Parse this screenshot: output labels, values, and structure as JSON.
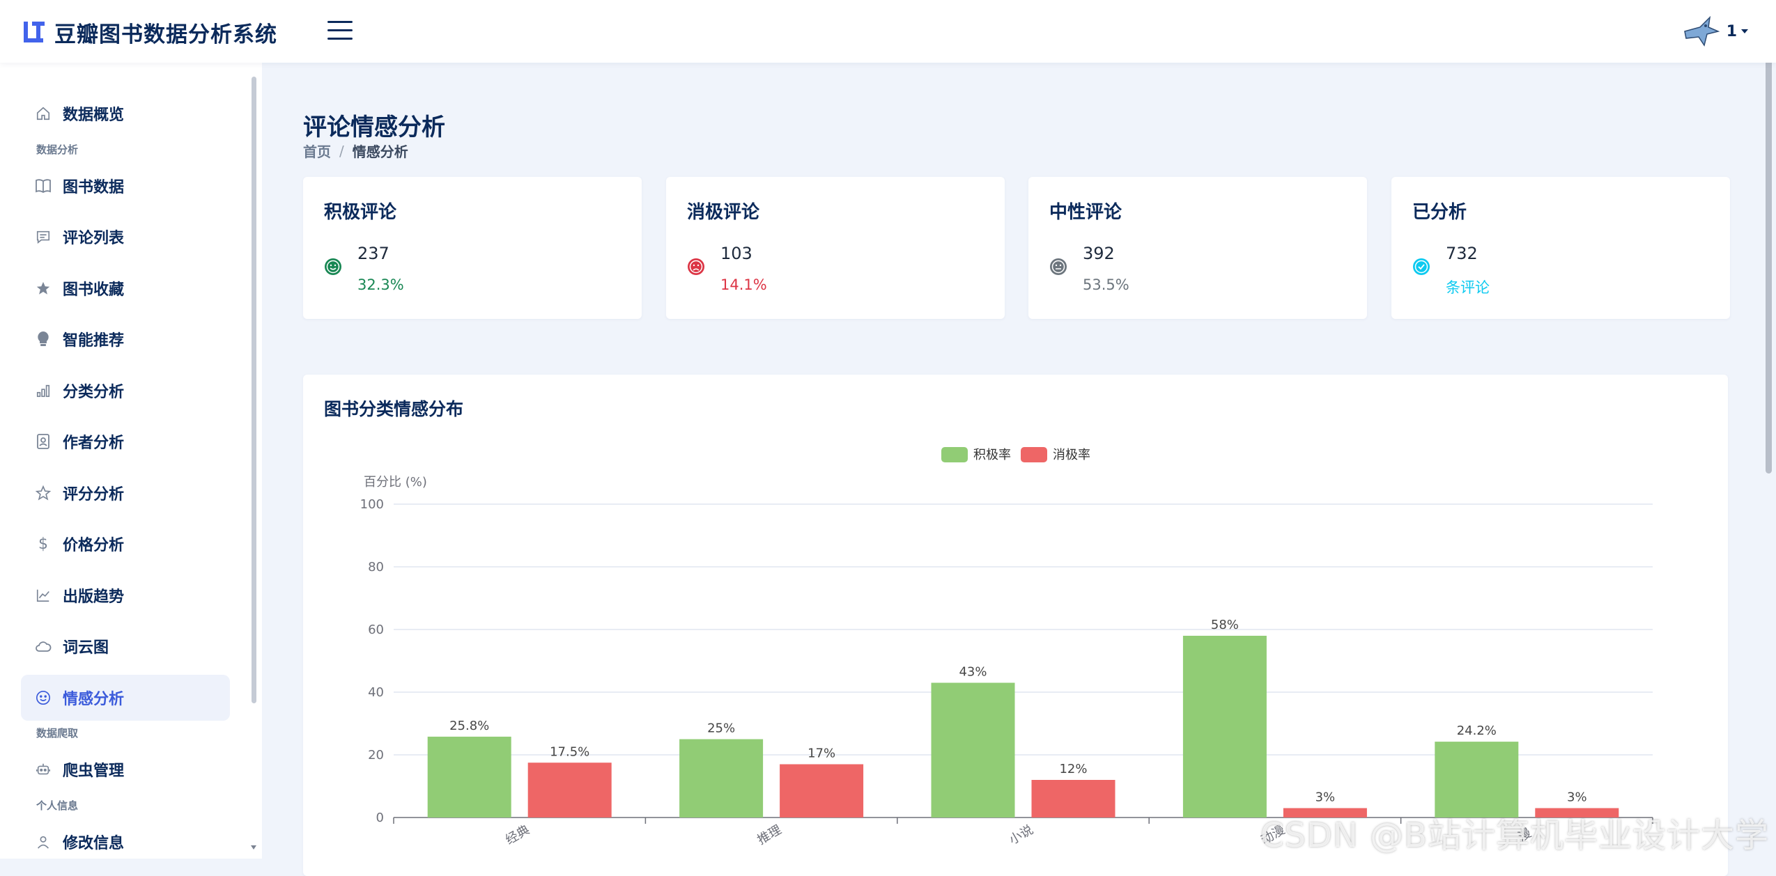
{
  "app": {
    "title": "豆瓣图书数据分析系统"
  },
  "user": {
    "name": "1"
  },
  "sidebar": {
    "items": [
      {
        "label": "数据概览",
        "icon": "home-icon"
      },
      {
        "section": "数据分析"
      },
      {
        "label": "图书数据",
        "icon": "book-icon"
      },
      {
        "label": "评论列表",
        "icon": "comment-icon"
      },
      {
        "label": "图书收藏",
        "icon": "star-filled-icon"
      },
      {
        "label": "智能推荐",
        "icon": "lightbulb-icon"
      },
      {
        "label": "分类分析",
        "icon": "bar-chart-icon"
      },
      {
        "label": "作者分析",
        "icon": "person-badge-icon"
      },
      {
        "label": "评分分析",
        "icon": "star-outline-icon"
      },
      {
        "label": "价格分析",
        "icon": "dollar-icon"
      },
      {
        "label": "出版趋势",
        "icon": "line-chart-icon"
      },
      {
        "label": "词云图",
        "icon": "cloud-icon"
      },
      {
        "label": "情感分析",
        "icon": "smile-icon",
        "active": true
      },
      {
        "section": "数据爬取"
      },
      {
        "label": "爬虫管理",
        "icon": "robot-icon"
      },
      {
        "section": "个人信息"
      },
      {
        "label": "修改信息",
        "icon": "user-icon"
      }
    ],
    "labels": {
      "home": "数据概览",
      "section_analysis": "数据分析",
      "books": "图书数据",
      "comments": "评论列表",
      "favorites": "图书收藏",
      "recommend": "智能推荐",
      "category": "分类分析",
      "author": "作者分析",
      "rating": "评分分析",
      "price": "价格分析",
      "trend": "出版趋势",
      "wordcloud": "词云图",
      "sentiment": "情感分析",
      "section_crawl": "数据爬取",
      "crawler": "爬虫管理",
      "section_profile": "个人信息",
      "profile": "修改信息"
    }
  },
  "page": {
    "title": "评论情感分析",
    "breadcrumb": {
      "home": "首页",
      "separator": "/",
      "current": "情感分析"
    }
  },
  "stats": {
    "positive": {
      "title": "积极评论",
      "value": "237",
      "sub": "32.3%",
      "color": "#198754",
      "icon": "smile-icon"
    },
    "negative": {
      "title": "消极评论",
      "value": "103",
      "sub": "14.1%",
      "color": "#dc3545",
      "icon": "frown-icon"
    },
    "neutral": {
      "title": "中性评论",
      "value": "392",
      "sub": "53.5%",
      "color": "#6c757d",
      "icon": "neutral-face-icon"
    },
    "analyzed": {
      "title": "已分析",
      "value": "732",
      "sub": "条评论",
      "color": "#0dcaf0",
      "icon": "check-circle-icon"
    }
  },
  "chart_section": {
    "title": "图书分类情感分布"
  },
  "chart_data": {
    "type": "bar",
    "categories": [
      "经典",
      "推理",
      "小说",
      "动漫",
      "漫"
    ],
    "series": [
      {
        "name": "积极率",
        "values": [
          25.8,
          25,
          43,
          58,
          24.2
        ],
        "color": "#91cc75"
      },
      {
        "name": "消极率",
        "values": [
          17.5,
          17,
          12,
          3,
          3
        ],
        "color": "#ee6666"
      }
    ],
    "data_labels": [
      [
        "25.8%",
        "25%",
        "43%",
        "58%",
        "24.2%"
      ],
      [
        "17.5%",
        "17%",
        "12%",
        "3%",
        "3%"
      ]
    ],
    "ylabel": "百分比 (%)",
    "ylim": [
      0,
      100
    ],
    "yticks": [
      0,
      20,
      40,
      60,
      80,
      100
    ],
    "grid": true,
    "legend": "top-center"
  },
  "watermark": "CSDN @B站计算机毕业设计大学"
}
